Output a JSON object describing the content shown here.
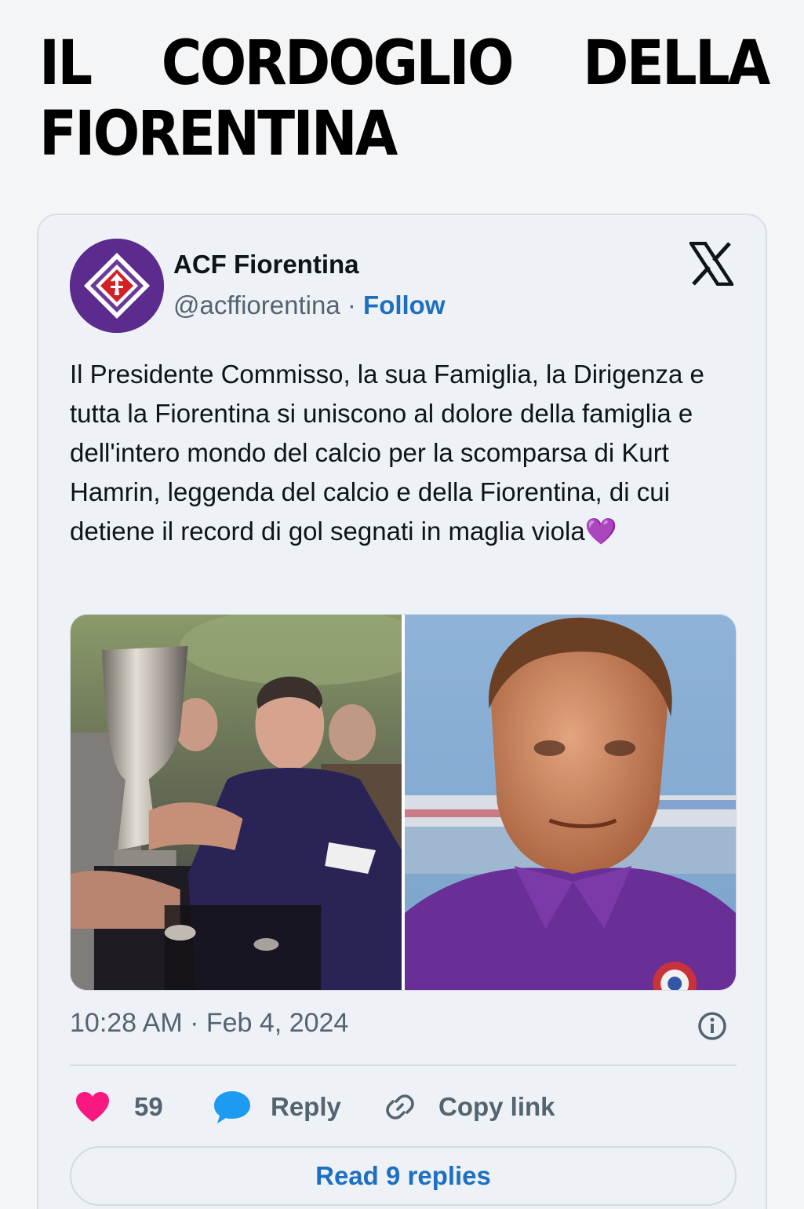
{
  "article": {
    "headline": "IL CORDOGLIO DELLA FIORENTINA"
  },
  "tweet": {
    "author": {
      "name": "ACF Fiorentina",
      "handle": "@acffiorentina",
      "separator": "·",
      "follow_label": "Follow"
    },
    "text": "Il Presidente Commisso, la sua Famiglia, la Dirigenza e tutta la Fiorentina si uniscono al dolore della famiglia e dell'intero mondo del calcio per la scomparsa di Kurt Hamrin, leggenda del calcio e della Fiorentina, di cui detiene il record di gol segnati in maglia viola",
    "emoji": "💜",
    "timestamp": "10:28 AM · Feb 4, 2024",
    "likes": "59",
    "reply_label": "Reply",
    "copy_link_label": "Copy link",
    "read_replies_label": "Read 9 replies"
  },
  "icons": {
    "logo": "x-logo-icon",
    "info": "info-icon",
    "like": "heart-icon",
    "reply": "speech-bubble-icon",
    "copy": "link-icon"
  },
  "colors": {
    "heart": "#f91880",
    "reply_bubble": "#1d9bf0",
    "link_blue": "#1d6fc2",
    "brand_purple": "#5a2d8c"
  }
}
